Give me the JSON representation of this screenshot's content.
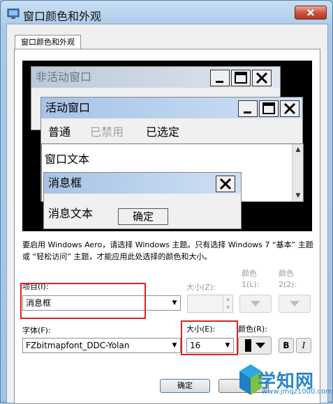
{
  "window": {
    "title": "窗口颜色和外观",
    "tab_label": "窗口颜色和外观"
  },
  "preview": {
    "inactive_title": "非活动窗口",
    "active_title": "活动窗口",
    "menu": [
      "普通",
      "已禁用",
      "已选定"
    ],
    "window_text": "窗口文本",
    "msgbox_title": "消息框",
    "msgbox_text": "消息文本",
    "msgbox_ok": "确定"
  },
  "description": "要启用 Windows Aero，请选择 Windows 主题。只有选择 Windows 7 “基本” 主题或 “轻松访问” 主题，才能应用此处选择的颜色和大小。",
  "item": {
    "label": "项目(I):",
    "value": "消息框",
    "size_label": "大小(Z):",
    "color1_label": [
      "颜色",
      "1(L):"
    ],
    "color2_label": [
      "颜色",
      "2(2):"
    ]
  },
  "font": {
    "label": "字体(F):",
    "value": "FZbitmapfont_DDC-Yolan",
    "size_label": "大小(E):",
    "size_value": "16",
    "color_label": "颜色(R):",
    "bold": "B",
    "italic": "I"
  },
  "buttons": {
    "ok": "确定"
  },
  "watermark": {
    "text": "学知网",
    "url": "www.jmqz1000.com"
  },
  "colors": {
    "highlight": "#e02020",
    "close_red": "#c7503a",
    "title_blue": "#a7c3e6"
  }
}
